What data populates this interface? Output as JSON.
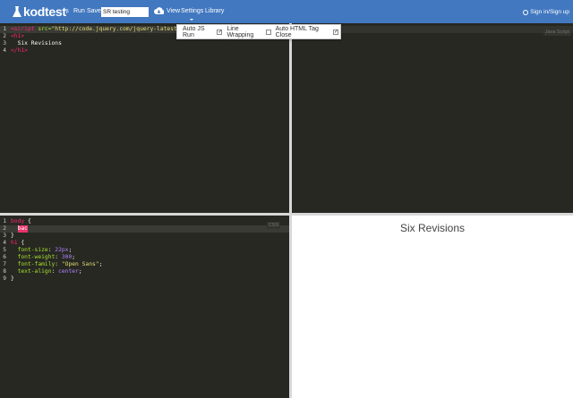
{
  "header": {
    "logo": "kodtest",
    "logo_sup": "β",
    "run": "Run",
    "save": "Save",
    "name_value": "SR testing",
    "view": "View",
    "settings": "Settings",
    "library": "Library",
    "signin": "Sign in/Sign up",
    "accent": "#4178c0"
  },
  "settings_menu": [
    {
      "label": "Auto JS Run",
      "checked": true
    },
    {
      "label": "Line Wrapping",
      "checked": false
    },
    {
      "label": "Auto HTML Tag Close",
      "checked": true
    }
  ],
  "html_editor": {
    "lines": [
      "1",
      "2",
      "3",
      "4"
    ],
    "line1_tag": "<script",
    "line1_attr": " src=",
    "line1_str": "\"http://code.jquery.com/jquery-latest.min.js\"",
    "line2": "<h1>",
    "line3": "  Six Revisions",
    "line4": "</h1>"
  },
  "js_editor": {
    "label": "Java Script"
  },
  "css_editor": {
    "label": "CSS",
    "lines": [
      "1",
      "2",
      "3",
      "4",
      "5",
      "6",
      "7",
      "8",
      "9"
    ],
    "body_sel": "body",
    "open": " {",
    "typed": "bac",
    "close": "}",
    "h1_sel": "h1",
    "props": [
      {
        "p": "  font-size",
        "v": "22px",
        "c": "num"
      },
      {
        "p": "  font-weight",
        "v": "300",
        "c": "num"
      },
      {
        "p": "  font-family",
        "v": "\"Open Sans\"",
        "c": "str"
      },
      {
        "p": "  text-align",
        "v": "center",
        "c": "num"
      }
    ]
  },
  "preview": {
    "title": "Six Revisions"
  }
}
